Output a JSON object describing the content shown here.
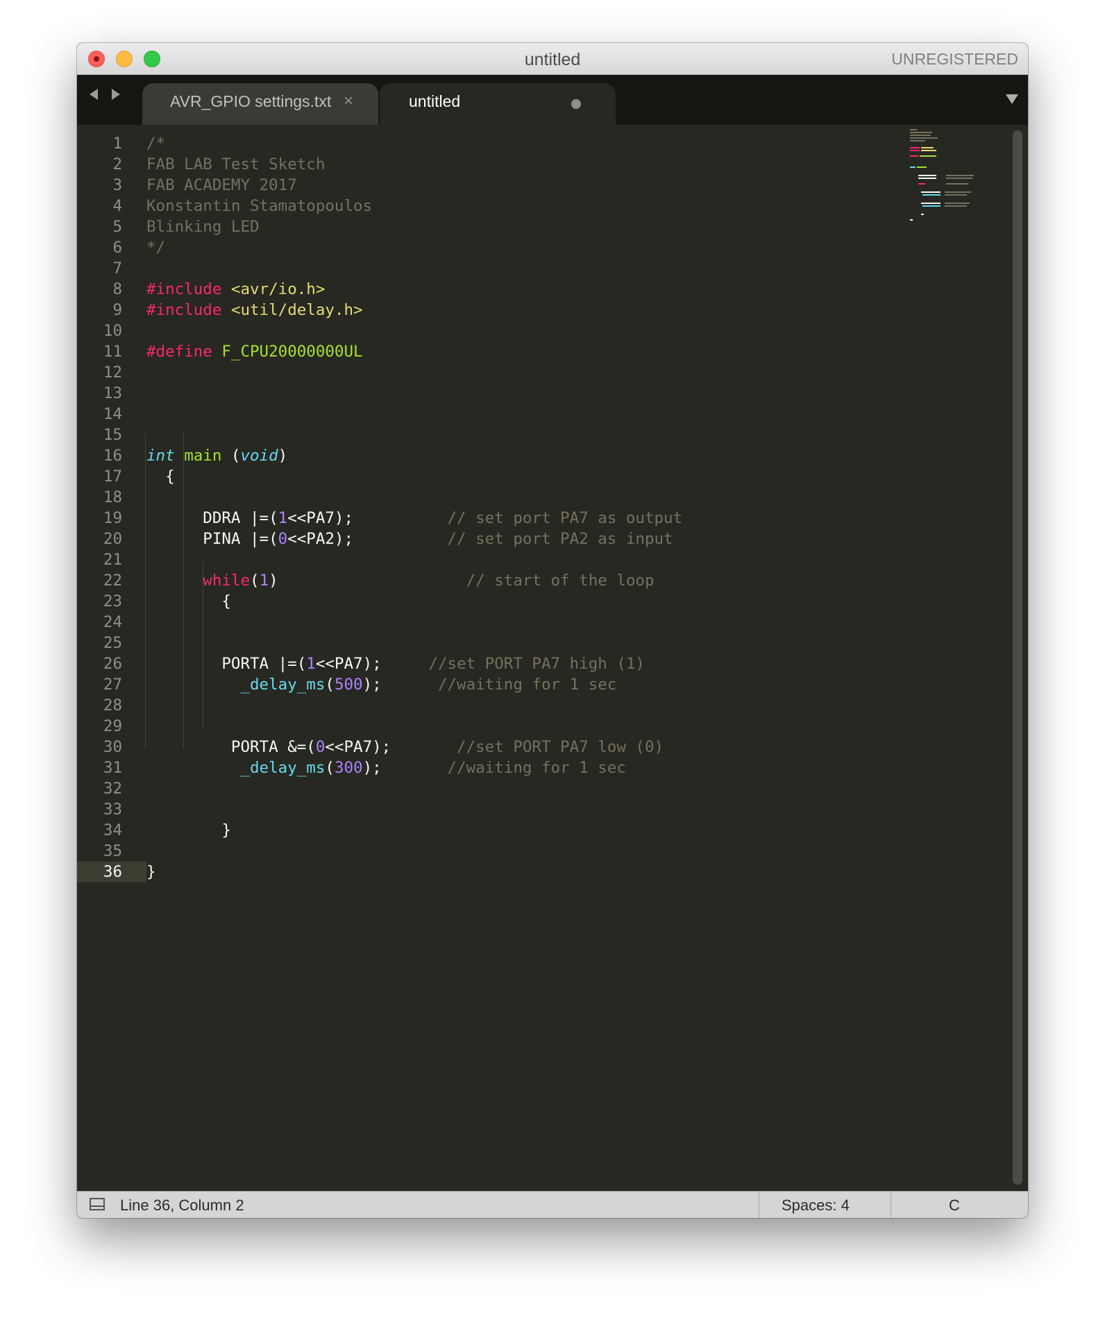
{
  "window": {
    "title": "untitled",
    "license_status": "UNREGISTERED"
  },
  "tabs": [
    {
      "label": "AVR_GPIO settings.txt",
      "close_glyph": "×",
      "active": false
    },
    {
      "label": "untitled",
      "dirty": true,
      "active": true
    }
  ],
  "icons": [
    "back-arrow-icon",
    "forward-arrow-icon",
    "close-icon",
    "dirty-dot-icon",
    "tab-menu-icon",
    "panel-toggle-icon"
  ],
  "editor": {
    "active_line": 36,
    "theme_colors": {
      "background": "#272822",
      "comment": "#75715e",
      "keyword": "#f92672",
      "string": "#e6db74",
      "function": "#a6e22e",
      "type": "#66d9ef",
      "number": "#ae81ff",
      "text": "#f8f8f2"
    },
    "lines": [
      {
        "n": "1",
        "tokens": [
          {
            "t": "/*",
            "c": "comment"
          }
        ]
      },
      {
        "n": "2",
        "tokens": [
          {
            "t": "FAB LAB Test Sketch",
            "c": "comment"
          }
        ]
      },
      {
        "n": "3",
        "tokens": [
          {
            "t": "FAB ACADEMY 2017",
            "c": "comment"
          }
        ]
      },
      {
        "n": "4",
        "tokens": [
          {
            "t": "Konstantin Stamatopoulos",
            "c": "comment"
          }
        ]
      },
      {
        "n": "5",
        "tokens": [
          {
            "t": "Blinking LED",
            "c": "comment"
          }
        ]
      },
      {
        "n": "6",
        "tokens": [
          {
            "t": "*/",
            "c": "comment"
          }
        ]
      },
      {
        "n": "7",
        "tokens": []
      },
      {
        "n": "8",
        "tokens": [
          {
            "t": "#include",
            "c": "pink"
          },
          {
            "t": " ",
            "c": "plain"
          },
          {
            "t": "<avr/io.h>",
            "c": "yellow"
          }
        ]
      },
      {
        "n": "9",
        "tokens": [
          {
            "t": "#include",
            "c": "pink"
          },
          {
            "t": " ",
            "c": "plain"
          },
          {
            "t": "<util/delay.h>",
            "c": "yellow"
          }
        ]
      },
      {
        "n": "10",
        "tokens": []
      },
      {
        "n": "11",
        "tokens": [
          {
            "t": "#define",
            "c": "pink"
          },
          {
            "t": " ",
            "c": "plain"
          },
          {
            "t": "F_CPU20000000UL",
            "c": "green"
          }
        ]
      },
      {
        "n": "12",
        "tokens": []
      },
      {
        "n": "13",
        "tokens": []
      },
      {
        "n": "14",
        "tokens": []
      },
      {
        "n": "15",
        "tokens": []
      },
      {
        "n": "16",
        "tokens": [
          {
            "t": "int",
            "c": "cyan-it"
          },
          {
            "t": " ",
            "c": "plain"
          },
          {
            "t": "main",
            "c": "green"
          },
          {
            "t": " (",
            "c": "plain"
          },
          {
            "t": "void",
            "c": "cyan-it"
          },
          {
            "t": ")",
            "c": "plain"
          }
        ]
      },
      {
        "n": "17",
        "tokens": [
          {
            "t": "  {",
            "c": "plain"
          }
        ]
      },
      {
        "n": "18",
        "tokens": []
      },
      {
        "n": "19",
        "tokens": [
          {
            "t": "      DDRA |=(",
            "c": "plain"
          },
          {
            "t": "1",
            "c": "purple"
          },
          {
            "t": "<<PA7);          ",
            "c": "plain"
          },
          {
            "t": "// set port PA7 as output",
            "c": "comment"
          }
        ]
      },
      {
        "n": "20",
        "tokens": [
          {
            "t": "      PINA |=(",
            "c": "plain"
          },
          {
            "t": "0",
            "c": "purple"
          },
          {
            "t": "<<PA2);          ",
            "c": "plain"
          },
          {
            "t": "// set port PA2 as input",
            "c": "comment"
          }
        ]
      },
      {
        "n": "21",
        "tokens": []
      },
      {
        "n": "22",
        "tokens": [
          {
            "t": "      ",
            "c": "plain"
          },
          {
            "t": "while",
            "c": "pink"
          },
          {
            "t": "(",
            "c": "plain"
          },
          {
            "t": "1",
            "c": "purple"
          },
          {
            "t": ")                    ",
            "c": "plain"
          },
          {
            "t": "// start of the loop",
            "c": "comment"
          }
        ]
      },
      {
        "n": "23",
        "tokens": [
          {
            "t": "        {",
            "c": "plain"
          }
        ]
      },
      {
        "n": "24",
        "tokens": []
      },
      {
        "n": "25",
        "tokens": []
      },
      {
        "n": "26",
        "tokens": [
          {
            "t": "        PORTA |=(",
            "c": "plain"
          },
          {
            "t": "1",
            "c": "purple"
          },
          {
            "t": "<<PA7);     ",
            "c": "plain"
          },
          {
            "t": "//set PORT PA7 high (1)",
            "c": "comment"
          }
        ]
      },
      {
        "n": "27",
        "tokens": [
          {
            "t": "          ",
            "c": "plain"
          },
          {
            "t": "_delay_ms",
            "c": "cyan"
          },
          {
            "t": "(",
            "c": "plain"
          },
          {
            "t": "500",
            "c": "purple"
          },
          {
            "t": ");      ",
            "c": "plain"
          },
          {
            "t": "//waiting for 1 sec",
            "c": "comment"
          }
        ]
      },
      {
        "n": "28",
        "tokens": []
      },
      {
        "n": "29",
        "tokens": []
      },
      {
        "n": "30",
        "tokens": [
          {
            "t": "         PORTA &=(",
            "c": "plain"
          },
          {
            "t": "0",
            "c": "purple"
          },
          {
            "t": "<<PA7);       ",
            "c": "plain"
          },
          {
            "t": "//set PORT PA7 low (0)",
            "c": "comment"
          }
        ]
      },
      {
        "n": "31",
        "tokens": [
          {
            "t": "          ",
            "c": "plain"
          },
          {
            "t": "_delay_ms",
            "c": "cyan"
          },
          {
            "t": "(",
            "c": "plain"
          },
          {
            "t": "300",
            "c": "purple"
          },
          {
            "t": ");       ",
            "c": "plain"
          },
          {
            "t": "//waiting for 1 sec",
            "c": "comment"
          }
        ]
      },
      {
        "n": "32",
        "tokens": []
      },
      {
        "n": "33",
        "tokens": []
      },
      {
        "n": "34",
        "tokens": [
          {
            "t": "        }",
            "c": "plain"
          }
        ]
      },
      {
        "n": "35",
        "tokens": []
      },
      {
        "n": "36",
        "tokens": [
          {
            "t": "}",
            "c": "plain"
          }
        ]
      }
    ]
  },
  "statusbar": {
    "cursor_position": "Line 36, Column 2",
    "indentation": "Spaces: 4",
    "syntax": "C"
  }
}
